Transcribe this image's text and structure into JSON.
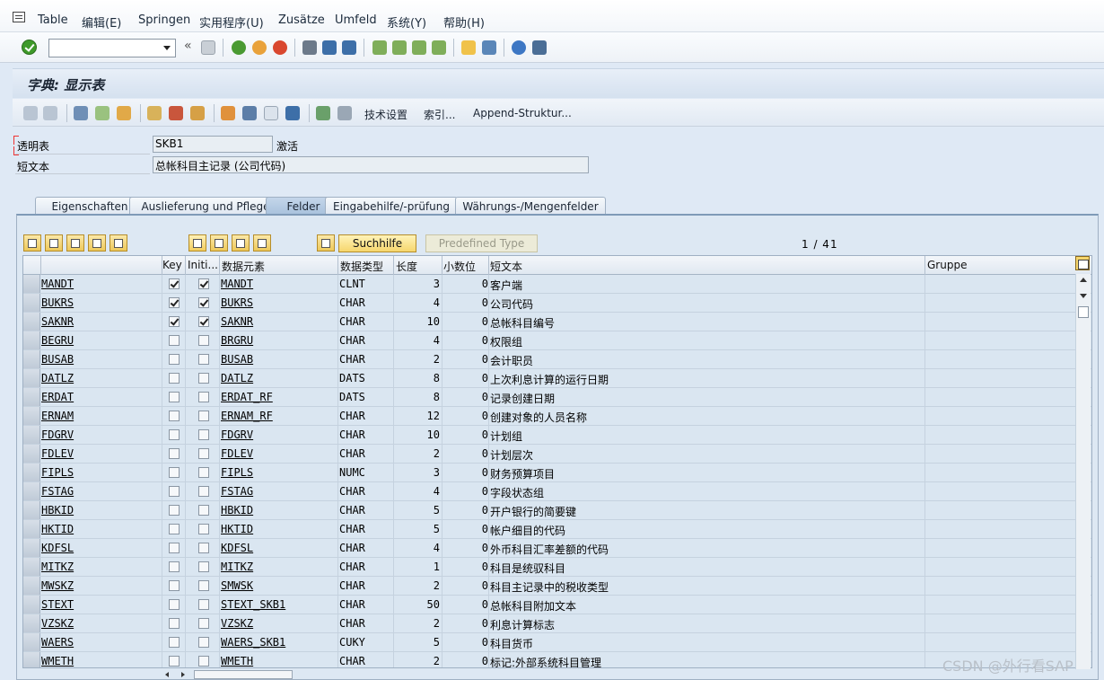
{
  "menu": {
    "items": [
      "Table",
      "编辑(E)",
      "Springen",
      "实用程序(U)",
      "Zusätze",
      "Umfeld",
      "系统(Y)",
      "帮助(H)"
    ]
  },
  "title": "字典: 显示表",
  "app_toolbar": {
    "tech_settings": "技术设置",
    "index": "索引...",
    "append": "Append-Struktur..."
  },
  "header": {
    "table_label": "透明表",
    "table_value": "SKB1",
    "status": "激活",
    "short_text_label": "短文本",
    "short_text_value": "总帐科目主记录 (公司代码)"
  },
  "tabs": [
    {
      "label": "Eigenschaften"
    },
    {
      "label": "Auslieferung und Pflege"
    },
    {
      "label": "Felder"
    },
    {
      "label": "Eingabehilfe/-prüfung"
    },
    {
      "label": "Währungs-/Mengenfelder"
    }
  ],
  "grid_toolbar": {
    "search_help": "Suchhilfe",
    "predefined_type": "Predefined Type",
    "pager": "1 / 41"
  },
  "columns": [
    "Key",
    "Initi...",
    "数据元素",
    "数据类型",
    "长度",
    "小数位",
    "短文本",
    "Gruppe"
  ],
  "rows": [
    {
      "field": "MANDT",
      "key": true,
      "init": true,
      "element": "MANDT",
      "type": "CLNT",
      "len": "3",
      "dec": "0",
      "text": "客户端"
    },
    {
      "field": "BUKRS",
      "key": true,
      "init": true,
      "element": "BUKRS",
      "type": "CHAR",
      "len": "4",
      "dec": "0",
      "text": "公司代码"
    },
    {
      "field": "SAKNR",
      "key": true,
      "init": true,
      "element": "SAKNR",
      "type": "CHAR",
      "len": "10",
      "dec": "0",
      "text": "总帐科目编号"
    },
    {
      "field": "BEGRU",
      "key": false,
      "init": false,
      "element": "BRGRU",
      "type": "CHAR",
      "len": "4",
      "dec": "0",
      "text": "权限组"
    },
    {
      "field": "BUSAB",
      "key": false,
      "init": false,
      "element": "BUSAB",
      "type": "CHAR",
      "len": "2",
      "dec": "0",
      "text": "会计职员"
    },
    {
      "field": "DATLZ",
      "key": false,
      "init": false,
      "element": "DATLZ",
      "type": "DATS",
      "len": "8",
      "dec": "0",
      "text": "上次利息计算的运行日期"
    },
    {
      "field": "ERDAT",
      "key": false,
      "init": false,
      "element": "ERDAT_RF",
      "type": "DATS",
      "len": "8",
      "dec": "0",
      "text": "记录创建日期"
    },
    {
      "field": "ERNAM",
      "key": false,
      "init": false,
      "element": "ERNAM_RF",
      "type": "CHAR",
      "len": "12",
      "dec": "0",
      "text": "创建对象的人员名称"
    },
    {
      "field": "FDGRV",
      "key": false,
      "init": false,
      "element": "FDGRV",
      "type": "CHAR",
      "len": "10",
      "dec": "0",
      "text": "计划组"
    },
    {
      "field": "FDLEV",
      "key": false,
      "init": false,
      "element": "FDLEV",
      "type": "CHAR",
      "len": "2",
      "dec": "0",
      "text": "计划层次"
    },
    {
      "field": "FIPLS",
      "key": false,
      "init": false,
      "element": "FIPLS",
      "type": "NUMC",
      "len": "3",
      "dec": "0",
      "text": "财务预算项目"
    },
    {
      "field": "FSTAG",
      "key": false,
      "init": false,
      "element": "FSTAG",
      "type": "CHAR",
      "len": "4",
      "dec": "0",
      "text": "字段状态组"
    },
    {
      "field": "HBKID",
      "key": false,
      "init": false,
      "element": "HBKID",
      "type": "CHAR",
      "len": "5",
      "dec": "0",
      "text": "开户银行的简要键"
    },
    {
      "field": "HKTID",
      "key": false,
      "init": false,
      "element": "HKTID",
      "type": "CHAR",
      "len": "5",
      "dec": "0",
      "text": "帐户细目的代码"
    },
    {
      "field": "KDFSL",
      "key": false,
      "init": false,
      "element": "KDFSL",
      "type": "CHAR",
      "len": "4",
      "dec": "0",
      "text": "外币科目汇率差额的代码"
    },
    {
      "field": "MITKZ",
      "key": false,
      "init": false,
      "element": "MITKZ",
      "type": "CHAR",
      "len": "1",
      "dec": "0",
      "text": "科目是统驭科目"
    },
    {
      "field": "MWSKZ",
      "key": false,
      "init": false,
      "element": "SMWSK",
      "type": "CHAR",
      "len": "2",
      "dec": "0",
      "text": "科目主记录中的税收类型"
    },
    {
      "field": "STEXT",
      "key": false,
      "init": false,
      "element": "STEXT_SKB1",
      "type": "CHAR",
      "len": "50",
      "dec": "0",
      "text": "总帐科目附加文本"
    },
    {
      "field": "VZSKZ",
      "key": false,
      "init": false,
      "element": "VZSKZ",
      "type": "CHAR",
      "len": "2",
      "dec": "0",
      "text": "利息计算标志"
    },
    {
      "field": "WAERS",
      "key": false,
      "init": false,
      "element": "WAERS_SKB1",
      "type": "CUKY",
      "len": "5",
      "dec": "0",
      "text": "科目货币"
    },
    {
      "field": "WMETH",
      "key": false,
      "init": false,
      "element": "WMETH",
      "type": "CHAR",
      "len": "2",
      "dec": "0",
      "text": "标记:外部系统科目管理"
    }
  ],
  "watermark": "CSDN @外行看SAP"
}
